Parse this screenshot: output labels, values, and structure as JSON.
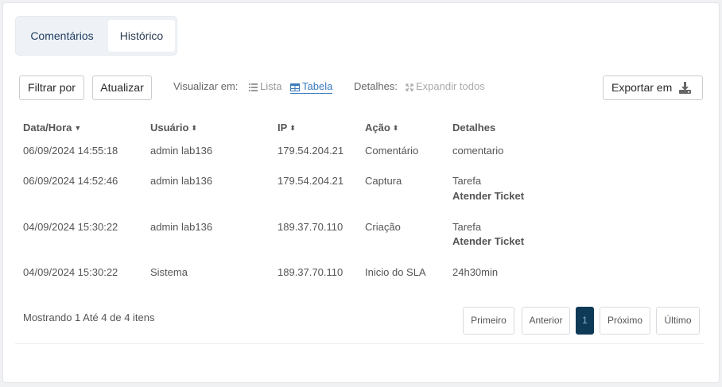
{
  "tabs": [
    {
      "label": "Comentários"
    },
    {
      "label": "Histórico"
    }
  ],
  "toolbar": {
    "filter_label": "Filtrar por",
    "refresh_label": "Atualizar",
    "view_label": "Visualizar em:",
    "view_list": "Lista",
    "view_table": "Tabela",
    "details_label": "Detalhes:",
    "expand_all": "Expandir todos",
    "export_label": "Exportar em"
  },
  "table": {
    "headers": [
      "Data/Hora",
      "Usuário",
      "IP",
      "Ação",
      "Detalhes"
    ],
    "rows": [
      {
        "datetime": "06/09/2024 14:55:18",
        "user": "admin lab136",
        "ip": "179.54.204.21",
        "action": "Comentário",
        "detail": "comentario",
        "detail_bold": ""
      },
      {
        "datetime": "06/09/2024 14:52:46",
        "user": "admin lab136",
        "ip": "179.54.204.21",
        "action": "Captura",
        "detail": "Tarefa",
        "detail_bold": "Atender Ticket"
      },
      {
        "datetime": "04/09/2024 15:30:22",
        "user": "admin lab136",
        "ip": "189.37.70.110",
        "action": "Criação",
        "detail": "Tarefa",
        "detail_bold": "Atender Ticket"
      },
      {
        "datetime": "04/09/2024 15:30:22",
        "user": "Sistema",
        "ip": "189.37.70.110",
        "action": "Inicio do SLA",
        "detail": "24h30min",
        "detail_bold": ""
      }
    ]
  },
  "summary": "Mostrando 1 Até 4 de 4 itens",
  "pagination": {
    "first": "Primeiro",
    "prev": "Anterior",
    "current": "1",
    "next": "Próximo",
    "last": "Último"
  },
  "colors": {
    "active_page": "#0e3a58",
    "link": "#3a7bbf"
  }
}
